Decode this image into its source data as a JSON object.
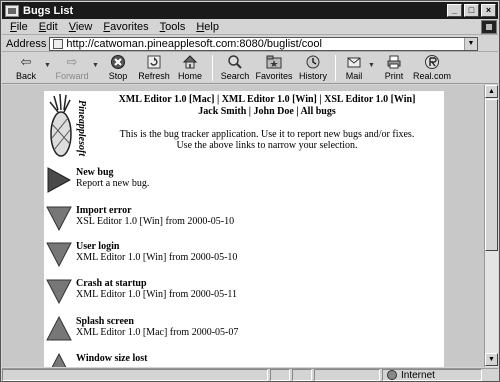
{
  "window": {
    "title": "Bugs List"
  },
  "menu": [
    {
      "label": "File",
      "u": "F",
      "rest": "ile"
    },
    {
      "label": "Edit",
      "u": "E",
      "rest": "dit"
    },
    {
      "label": "View",
      "u": "V",
      "rest": "iew"
    },
    {
      "label": "Favorites",
      "u": "F",
      "rest": "avorites",
      "pre": ""
    },
    {
      "label": "Tools",
      "u": "T",
      "rest": "ools"
    },
    {
      "label": "Help",
      "u": "H",
      "rest": "elp"
    }
  ],
  "address": {
    "label": "Address",
    "url": "http://catwoman.pineapplesoft.com:8080/buglist/cool"
  },
  "toolbar": {
    "back": "Back",
    "forward": "Forward",
    "stop": "Stop",
    "refresh": "Refresh",
    "home": "Home",
    "search": "Search",
    "favorites": "Favorites",
    "history": "History",
    "mail": "Mail",
    "print": "Print",
    "realcom": "Real.com"
  },
  "page": {
    "logo_text": "Pineapplesoft",
    "header_line1": "XML Editor 1.0 [Mac] | XML Editor 1.0 [Win] | XSL Editor 1.0 [Win]",
    "header_line2": "Jack Smith | John Doe | All bugs",
    "intro_line1": "This is the bug tracker application. Use it to report new bugs and/or fixes.",
    "intro_line2": "Use the above links to narrow your selection.",
    "bugs": [
      {
        "title": "New bug",
        "desc": "Report a new bug.",
        "icon": "play-right-icon"
      },
      {
        "title": "Import error",
        "desc": "XSL Editor 1.0 [Win] from 2000-05-10",
        "icon": "triangle-down-icon"
      },
      {
        "title": "User login",
        "desc": "XML Editor 1.0 [Win] from 2000-05-10",
        "icon": "triangle-down-icon"
      },
      {
        "title": "Crash at startup",
        "desc": "XML Editor 1.0 [Win] from 2000-05-11",
        "icon": "triangle-down-icon"
      },
      {
        "title": "Splash screen",
        "desc": "XML Editor 1.0 [Mac] from 2000-05-07",
        "icon": "triangle-up-icon"
      },
      {
        "title": "Window size lost",
        "desc": "",
        "icon": "triangle-up-icon"
      }
    ]
  },
  "status": {
    "zone": "Internet"
  }
}
